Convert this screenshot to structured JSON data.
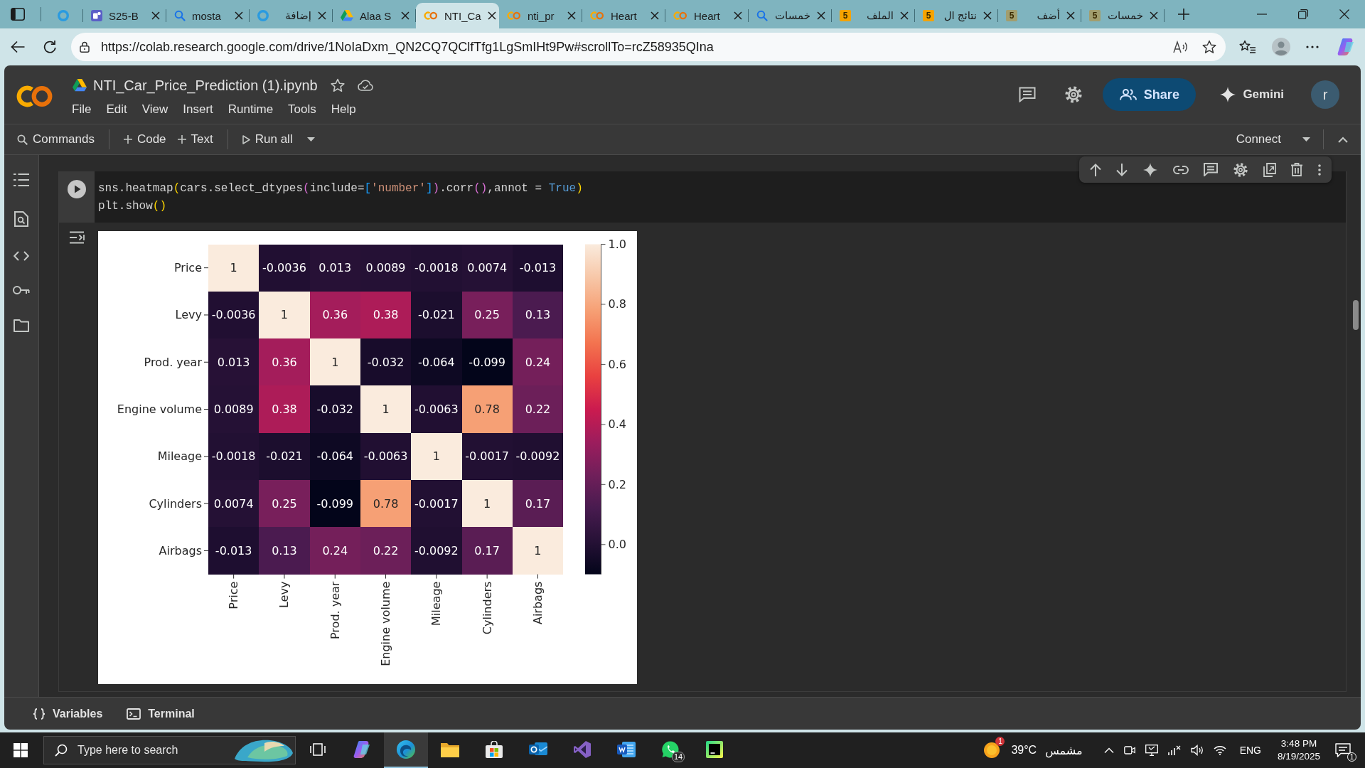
{
  "browser": {
    "tabs": [
      {
        "kind": "ring",
        "selected": false
      },
      {
        "kind": "tile",
        "label": "S25-B",
        "selected": false
      },
      {
        "kind": "search",
        "label": "mosta",
        "selected": false
      },
      {
        "kind": "ring",
        "label": "إضافة",
        "selected": false
      },
      {
        "kind": "triangle",
        "label": "Alaa S",
        "selected": false
      },
      {
        "kind": "rings",
        "label": "NTI_Ca",
        "selected": true
      },
      {
        "kind": "rings",
        "label": "nti_pr",
        "selected": false
      },
      {
        "kind": "rings",
        "label": "Heart",
        "selected": false
      },
      {
        "kind": "rings",
        "label": "Heart",
        "selected": false
      },
      {
        "kind": "search",
        "label": "خمسات",
        "selected": false
      },
      {
        "kind": "badge",
        "badge": "5",
        "color": "#f5a300",
        "label": "الملف",
        "selected": false
      },
      {
        "kind": "badge",
        "badge": "5",
        "color": "#f5a300",
        "label": "نتائج ال",
        "selected": false
      },
      {
        "kind": "badge",
        "badge": "5",
        "color": "#a29e6e",
        "label": "أضف",
        "selected": false
      },
      {
        "kind": "badge",
        "badge": "5",
        "color": "#a29e6e",
        "label": "خمسات",
        "selected": false
      }
    ],
    "address_bar": {
      "url": "https://colab.research.google.com/drive/1NoIaDxm_QN2CQ7QClfTfg1LgSmIHt9Pw#scrollTo=rcZ58935QIna"
    }
  },
  "notebook": {
    "title": "NTI_Car_Price_Prediction (1).ipynb",
    "menu": [
      "File",
      "Edit",
      "View",
      "Insert",
      "Runtime",
      "Tools",
      "Help"
    ],
    "share_label": "Share",
    "gemini_label": "Gemini",
    "avatar_letter": "r"
  },
  "toolbar": {
    "groups": [
      [
        {
          "kind": "search",
          "label": "Commands"
        }
      ],
      [
        {
          "kind": "add",
          "label": "Code"
        },
        {
          "kind": "add",
          "label": "Text"
        }
      ],
      [
        {
          "kind": "run",
          "label": "Run all"
        }
      ]
    ],
    "connect_label": "Connect"
  },
  "cell": {
    "code_lines": [
      [
        {
          "kind": "plain",
          "text": "sns.heatmap"
        },
        {
          "kind": "bracket1",
          "text": "("
        },
        {
          "kind": "plain",
          "text": "cars.select_dtypes"
        },
        {
          "kind": "bracket2",
          "text": "("
        },
        {
          "kind": "plain",
          "text": "include="
        },
        {
          "kind": "bracket3",
          "text": "["
        },
        {
          "kind": "string",
          "text": "'number'"
        },
        {
          "kind": "bracket3",
          "text": "]"
        },
        {
          "kind": "bracket2",
          "text": ")"
        },
        {
          "kind": "plain",
          "text": ".corr"
        },
        {
          "kind": "bracket2",
          "text": "()"
        },
        {
          "kind": "plain",
          "text": ",annot = "
        },
        {
          "kind": "constant",
          "text": "True"
        },
        {
          "kind": "bracket1",
          "text": ")"
        }
      ],
      [
        {
          "kind": "plain",
          "text": "plt.show"
        },
        {
          "kind": "bracket1",
          "text": "()"
        }
      ]
    ]
  },
  "output": {
    "chart_data": {
      "type": "heatmap",
      "categories": [
        "Price",
        "Levy",
        "Prod. year",
        "Engine volume",
        "Mileage",
        "Cylinders",
        "Airbags"
      ],
      "y_categories": [
        "Price",
        "Levy",
        "Prod. year",
        "Engine volume",
        "Mileage",
        "Cylinders",
        "Airbags"
      ],
      "cells": [
        [
          1,
          -0.0036,
          0.013,
          0.0089,
          -0.0018,
          0.0074,
          -0.013
        ],
        [
          -0.0036,
          1,
          0.36,
          0.38,
          -0.021,
          0.25,
          0.13
        ],
        [
          0.013,
          0.36,
          1,
          -0.032,
          -0.064,
          -0.099,
          0.24
        ],
        [
          0.0089,
          0.38,
          -0.032,
          1,
          -0.0063,
          0.78,
          0.22
        ],
        [
          -0.0018,
          -0.021,
          -0.064,
          -0.0063,
          1,
          -0.0017,
          -0.0092
        ],
        [
          0.0074,
          0.25,
          -0.099,
          0.78,
          -0.0017,
          1,
          0.17
        ],
        [
          -0.013,
          0.13,
          0.24,
          0.22,
          -0.0092,
          0.17,
          1
        ]
      ],
      "data_labels": true,
      "y2lim": [
        -0.099,
        1
      ],
      "y2ticks": [
        {
          "value": 0,
          "label": "0.0"
        },
        {
          "value": 0.2,
          "label": "0.2"
        },
        {
          "value": 0.4,
          "label": "0.4"
        },
        {
          "value": 0.6,
          "label": "0.6"
        },
        {
          "value": 0.8,
          "label": "0.8"
        },
        {
          "value": 1,
          "label": "1.0"
        }
      ]
    }
  },
  "bottom_bar": {
    "items": [
      {
        "kind": "variables",
        "label": "Variables"
      },
      {
        "kind": "terminal",
        "label": "Terminal"
      }
    ]
  },
  "taskbar": {
    "search_placeholder": "Type here to search",
    "apps": [
      {
        "kind": "taskview",
        "selected": false
      },
      {
        "kind": "swirl",
        "selected": false
      },
      {
        "kind": "wave",
        "selected": true
      },
      {
        "kind": "folder",
        "selected": false
      },
      {
        "kind": "bag",
        "selected": false
      },
      {
        "kind": "mail",
        "selected": false
      },
      {
        "kind": "ribbon",
        "selected": false
      },
      {
        "kind": "document",
        "selected": false
      },
      {
        "kind": "chat",
        "badge": "14",
        "selected": false
      },
      {
        "kind": "square",
        "selected": false
      }
    ],
    "weather": {
      "badge": "1",
      "temperature": "39°C",
      "condition": "مشمس"
    },
    "language": "ENG",
    "time": "3:48 PM",
    "date": "8/19/2025",
    "notification_badge": "1"
  }
}
